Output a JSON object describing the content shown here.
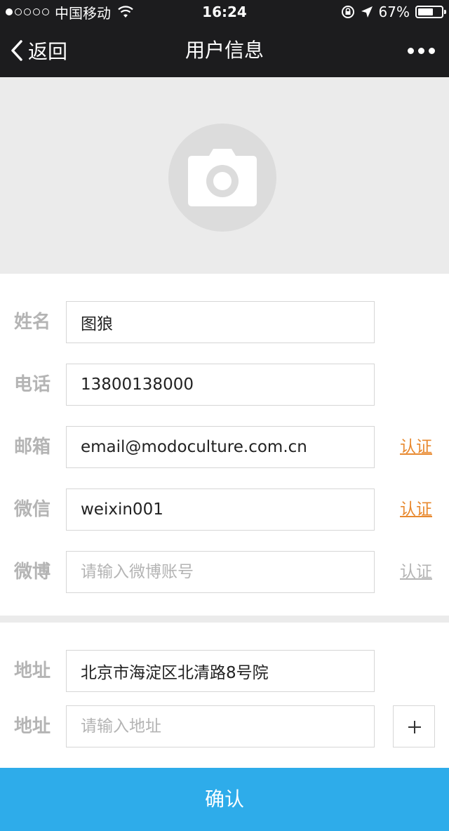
{
  "status_bar": {
    "carrier": "中国移动",
    "signal_bars_filled": 1,
    "signal_bars_total": 5,
    "time": "16:24",
    "battery_percent": "67%",
    "battery_level": 0.67
  },
  "nav": {
    "back_label": "返回",
    "title": "用户信息"
  },
  "form": {
    "fields": [
      {
        "label": "姓名",
        "value": "图狼",
        "placeholder": ""
      },
      {
        "label": "电话",
        "value": "13800138000",
        "placeholder": ""
      },
      {
        "label": "邮箱",
        "value": "email@modoculture.com.cn",
        "placeholder": "",
        "verify": "认证"
      },
      {
        "label": "微信",
        "value": "weixin001",
        "placeholder": "",
        "verify": "认证"
      },
      {
        "label": "微博",
        "value": "",
        "placeholder": "请输入微博账号",
        "verify": "认证"
      }
    ],
    "address": [
      {
        "label": "地址",
        "value": "北京市海淀区北清路8号院",
        "placeholder": ""
      },
      {
        "label": "地址",
        "value": "",
        "placeholder": "请输入地址"
      }
    ]
  },
  "confirm_label": "确认",
  "colors": {
    "nav_bg": "#1c1c1e",
    "accent_blue": "#2eacea",
    "verify_orange": "#e8892f",
    "muted_gray": "#b4b4b4"
  }
}
